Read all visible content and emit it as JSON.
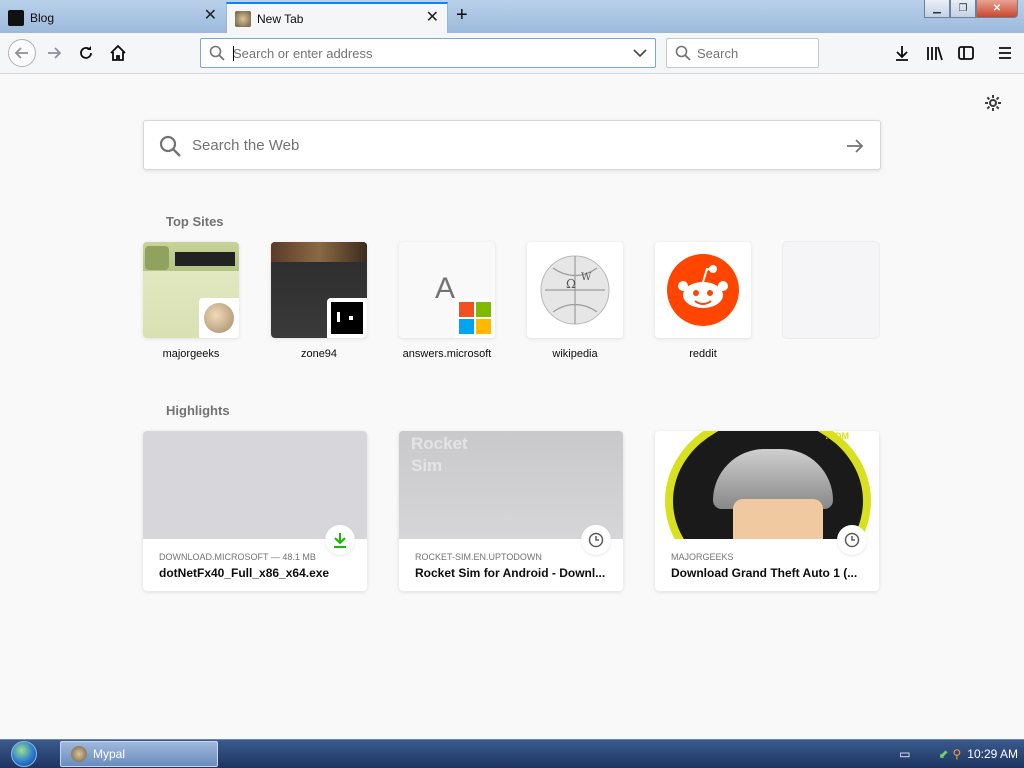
{
  "tabs": [
    {
      "title": "Blog",
      "active": false
    },
    {
      "title": "New Tab",
      "active": true
    }
  ],
  "navbar": {
    "url_placeholder": "Search or enter address",
    "search_placeholder": "Search"
  },
  "newtab": {
    "websearch_placeholder": "Search the Web",
    "top_sites_title": "Top Sites",
    "highlights_title": "Highlights",
    "top_sites": [
      {
        "label": "majorgeeks"
      },
      {
        "label": "zone94"
      },
      {
        "label": "answers.microsoft",
        "letter": "A"
      },
      {
        "label": "wikipedia"
      },
      {
        "label": "reddit"
      },
      {
        "label": ""
      }
    ],
    "highlights": [
      {
        "host": "DOWNLOAD.MICROSOFT — 48.1 MB",
        "title": "dotNetFx40_Full_x86_x64.exe",
        "badge": "download-icon",
        "thumb_text": ""
      },
      {
        "host": "ROCKET-SIM.EN.UPTODOWN",
        "title": "Rocket Sim for Android - Downl...",
        "badge": "clock-icon",
        "thumb_text": "Rocket Sim"
      },
      {
        "host": "MAJORGEEKS",
        "title": "Download Grand Theft Auto 1 (...",
        "badge": "clock-icon",
        "thumb_text": ".COM"
      }
    ]
  },
  "taskbar": {
    "app_label": "Mypal",
    "clock": "10:29 AM"
  },
  "colors": {
    "accent": "#0a84ff",
    "reddit": "#ff4500",
    "download_green": "#12bc00"
  }
}
